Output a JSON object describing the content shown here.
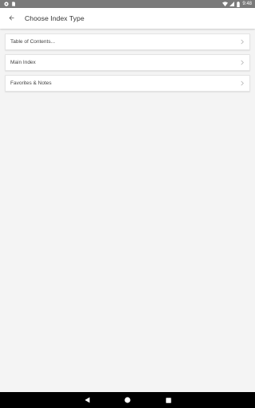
{
  "status_bar": {
    "time": "9:48",
    "left_icons": [
      "settings-icon",
      "sim-card-icon"
    ],
    "right_icons": [
      "wifi-icon",
      "signal-icon",
      "battery-icon"
    ]
  },
  "app_bar": {
    "back_icon": "arrow-left-icon",
    "title": "Choose Index Type"
  },
  "index_types": [
    {
      "label": "Table of Contents...",
      "icon": "chevron-right-icon"
    },
    {
      "label": "Main Index",
      "icon": "chevron-right-icon"
    },
    {
      "label": "Favorites & Notes",
      "icon": "chevron-right-icon"
    }
  ],
  "nav_bar": {
    "buttons": [
      "back-triangle-icon",
      "home-circle-icon",
      "recents-square-icon"
    ]
  },
  "colors": {
    "status_bar": "#7a7a7a",
    "app_bar": "#ffffff",
    "background": "#f4f4f4",
    "nav_bar": "#000000"
  }
}
